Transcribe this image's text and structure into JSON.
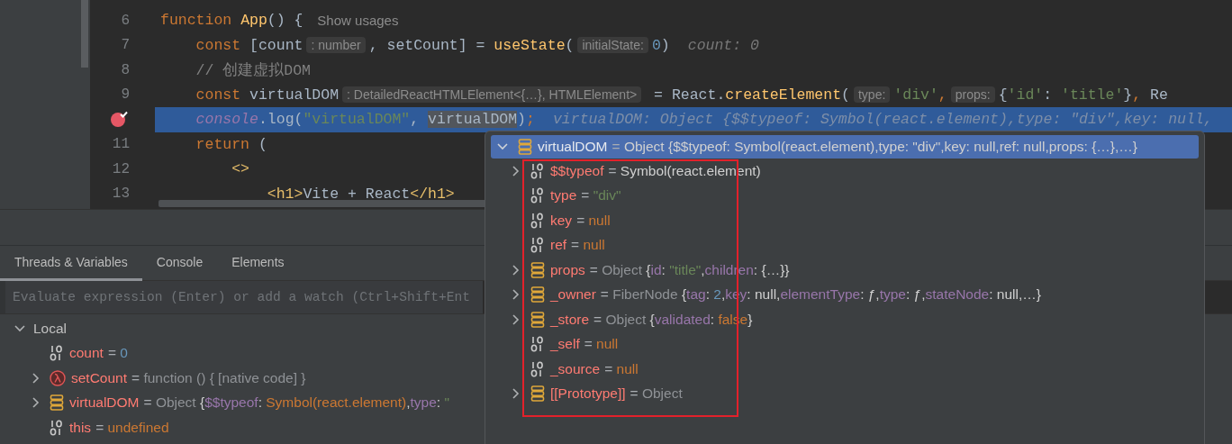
{
  "editor": {
    "lines": [
      {
        "number": "6",
        "breakpoint": false,
        "current": false,
        "tokens": [
          {
            "kind": "kw",
            "text": "function "
          },
          {
            "kind": "fn",
            "text": "App"
          },
          {
            "kind": "plain",
            "text": "() { "
          },
          {
            "kind": "note",
            "text": "Show usages"
          }
        ]
      },
      {
        "number": "7",
        "breakpoint": false,
        "current": false,
        "tokens": [
          {
            "kind": "kw",
            "text": "    const "
          },
          {
            "kind": "plain",
            "text": "[count"
          },
          {
            "kind": "hint",
            "text": ": number"
          },
          {
            "kind": "plain",
            "text": ", setCount] = "
          },
          {
            "kind": "fn",
            "text": "useState"
          },
          {
            "kind": "plain",
            "text": "("
          },
          {
            "kind": "hint",
            "text": "initialState:"
          },
          {
            "kind": "num",
            "text": "0"
          },
          {
            "kind": "plain",
            "text": ")"
          },
          {
            "kind": "inline",
            "text": "count: 0"
          }
        ]
      },
      {
        "number": "8",
        "breakpoint": false,
        "current": false,
        "tokens": [
          {
            "kind": "comment",
            "text": "    // 创建虚拟DOM"
          }
        ]
      },
      {
        "number": "9",
        "breakpoint": false,
        "current": false,
        "tokens": [
          {
            "kind": "kw",
            "text": "    const "
          },
          {
            "kind": "plain",
            "text": "virtualDOM"
          },
          {
            "kind": "hint",
            "text": ": DetailedReactHTMLElement<{…}, HTMLElement>"
          },
          {
            "kind": "plain",
            "text": " = React."
          },
          {
            "kind": "fn",
            "text": "createElement"
          },
          {
            "kind": "plain",
            "text": "("
          },
          {
            "kind": "hint",
            "text": "type:"
          },
          {
            "kind": "str",
            "text": "'div'"
          },
          {
            "kind": "kw",
            "text": ","
          },
          {
            "kind": "hint",
            "text": "props:"
          },
          {
            "kind": "plain",
            "text": "{"
          },
          {
            "kind": "str",
            "text": "'id'"
          },
          {
            "kind": "plain",
            "text": ": "
          },
          {
            "kind": "str",
            "text": "'title'"
          },
          {
            "kind": "plain",
            "text": "}"
          },
          {
            "kind": "kw",
            "text": ","
          },
          {
            "kind": "plain",
            "text": " Re"
          }
        ]
      },
      {
        "breakpoint": true,
        "current": true,
        "tokens": [
          {
            "kind": "italic",
            "text": "    console"
          },
          {
            "kind": "plain",
            "text": ".log("
          },
          {
            "kind": "str",
            "text": "\"virtualDOM\""
          },
          {
            "kind": "plain",
            "text": ", "
          },
          {
            "kind": "mark",
            "text": "virtualDOM"
          },
          {
            "kind": "plain",
            "text": ")"
          },
          {
            "kind": "kw",
            "text": ";"
          },
          {
            "kind": "inline",
            "text": "virtualDOM: Object {$$typeof: Symbol(react.element),type: \"div\",key: null,"
          }
        ]
      },
      {
        "number": "11",
        "breakpoint": false,
        "current": false,
        "tokens": [
          {
            "kind": "kw",
            "text": "    return "
          },
          {
            "kind": "plain",
            "text": "("
          }
        ]
      },
      {
        "number": "12",
        "breakpoint": false,
        "current": false,
        "tokens": [
          {
            "kind": "tag",
            "text": "        <>"
          }
        ]
      },
      {
        "number": "13",
        "breakpoint": false,
        "current": false,
        "tokens": [
          {
            "kind": "tag",
            "text": "            <h1>"
          },
          {
            "kind": "plain",
            "text": "Vite + React"
          },
          {
            "kind": "tag",
            "text": "</h1>"
          }
        ]
      }
    ]
  },
  "tabs": [
    {
      "label": "Threads & Variables",
      "selected": true
    },
    {
      "label": "Console",
      "selected": false
    },
    {
      "label": "Elements",
      "selected": false
    }
  ],
  "evaluate": {
    "placeholder": "Evaluate expression (Enter) or add a watch (Ctrl+Shift+Ent"
  },
  "local": {
    "label": "Local",
    "expanded": true,
    "children": [
      {
        "kind": "primitive",
        "expandable": false,
        "name": "count",
        "value": [
          {
            "kind": "eq",
            "text": "= "
          },
          {
            "kind": "num",
            "text": "0"
          }
        ]
      },
      {
        "kind": "function",
        "expandable": true,
        "name": "setCount",
        "value": [
          {
            "kind": "eq",
            "text": "= "
          },
          {
            "kind": "dim",
            "text": "function () { [native code] }"
          }
        ]
      },
      {
        "kind": "object",
        "expandable": true,
        "name": "virtualDOM",
        "value": [
          {
            "kind": "eq",
            "text": "= "
          },
          {
            "kind": "dim",
            "text": "Object "
          },
          {
            "kind": "plain",
            "text": "{"
          },
          {
            "kind": "prop",
            "text": "$$typeof"
          },
          {
            "kind": "plain",
            "text": ": "
          },
          {
            "kind": "kwv",
            "text": "Symbol(react.element)"
          },
          {
            "kind": "plain",
            "text": ","
          },
          {
            "kind": "prop",
            "text": "type"
          },
          {
            "kind": "plain",
            "text": ": "
          },
          {
            "kind": "str",
            "text": "\""
          }
        ]
      },
      {
        "kind": "primitive",
        "expandable": false,
        "name": "this",
        "value": [
          {
            "kind": "eq",
            "text": "= "
          },
          {
            "kind": "kwv",
            "text": "undefined"
          }
        ]
      }
    ]
  },
  "popup": {
    "root": {
      "kind": "object",
      "expanded": true,
      "selected": true,
      "name": "virtualDOM",
      "value": [
        {
          "kind": "eq",
          "text": "= "
        },
        {
          "kind": "plain",
          "text": "Object {$$typeof: Symbol(react.element),type: \"div\",key: null,ref: null,props: {…},…}"
        }
      ]
    },
    "children": [
      {
        "kind": "primitive",
        "expandable": true,
        "name": "$$typeof",
        "value": [
          {
            "kind": "eq",
            "text": "= "
          },
          {
            "kind": "plain",
            "text": "Symbol(react.element)"
          }
        ]
      },
      {
        "kind": "primitive",
        "expandable": false,
        "name": "type",
        "value": [
          {
            "kind": "eq",
            "text": "= "
          },
          {
            "kind": "str",
            "text": "\"div\""
          }
        ]
      },
      {
        "kind": "primitive",
        "expandable": false,
        "name": "key",
        "value": [
          {
            "kind": "eq",
            "text": "= "
          },
          {
            "kind": "kwv",
            "text": "null"
          }
        ]
      },
      {
        "kind": "primitive",
        "expandable": false,
        "name": "ref",
        "value": [
          {
            "kind": "eq",
            "text": "= "
          },
          {
            "kind": "kwv",
            "text": "null"
          }
        ]
      },
      {
        "kind": "object",
        "expandable": true,
        "name": "props",
        "value": [
          {
            "kind": "eq",
            "text": "= "
          },
          {
            "kind": "dim",
            "text": "Object "
          },
          {
            "kind": "plain",
            "text": "{"
          },
          {
            "kind": "prop",
            "text": "id"
          },
          {
            "kind": "plain",
            "text": ": "
          },
          {
            "kind": "str",
            "text": "\"title\""
          },
          {
            "kind": "plain",
            "text": ","
          },
          {
            "kind": "prop",
            "text": "children"
          },
          {
            "kind": "plain",
            "text": ": {…}}"
          }
        ]
      },
      {
        "kind": "object",
        "expandable": true,
        "name": "_owner",
        "value": [
          {
            "kind": "eq",
            "text": "= "
          },
          {
            "kind": "dim",
            "text": "FiberNode "
          },
          {
            "kind": "plain",
            "text": "{"
          },
          {
            "kind": "prop",
            "text": "tag"
          },
          {
            "kind": "plain",
            "text": ": "
          },
          {
            "kind": "num",
            "text": "2"
          },
          {
            "kind": "plain",
            "text": ","
          },
          {
            "kind": "prop",
            "text": "key"
          },
          {
            "kind": "plain",
            "text": ": null,"
          },
          {
            "kind": "prop",
            "text": "elementType"
          },
          {
            "kind": "plain",
            "text": ": ƒ,"
          },
          {
            "kind": "prop",
            "text": "type"
          },
          {
            "kind": "plain",
            "text": ": ƒ,"
          },
          {
            "kind": "prop",
            "text": "stateNode"
          },
          {
            "kind": "plain",
            "text": ": null,…}"
          }
        ]
      },
      {
        "kind": "object",
        "expandable": true,
        "name": "_store",
        "value": [
          {
            "kind": "eq",
            "text": "= "
          },
          {
            "kind": "dim",
            "text": "Object "
          },
          {
            "kind": "plain",
            "text": "{"
          },
          {
            "kind": "prop",
            "text": "validated"
          },
          {
            "kind": "plain",
            "text": ": "
          },
          {
            "kind": "kwv",
            "text": "false"
          },
          {
            "kind": "plain",
            "text": "}"
          }
        ]
      },
      {
        "kind": "primitive",
        "expandable": false,
        "name": "_self",
        "value": [
          {
            "kind": "eq",
            "text": "= "
          },
          {
            "kind": "kwv",
            "text": "null"
          }
        ]
      },
      {
        "kind": "primitive",
        "expandable": false,
        "name": "_source",
        "value": [
          {
            "kind": "eq",
            "text": "= "
          },
          {
            "kind": "kwv",
            "text": "null"
          }
        ]
      },
      {
        "kind": "object",
        "expandable": true,
        "name": "[[Prototype]]",
        "value": [
          {
            "kind": "eq",
            "text": "= "
          },
          {
            "kind": "dim",
            "text": "Object"
          }
        ]
      }
    ]
  }
}
